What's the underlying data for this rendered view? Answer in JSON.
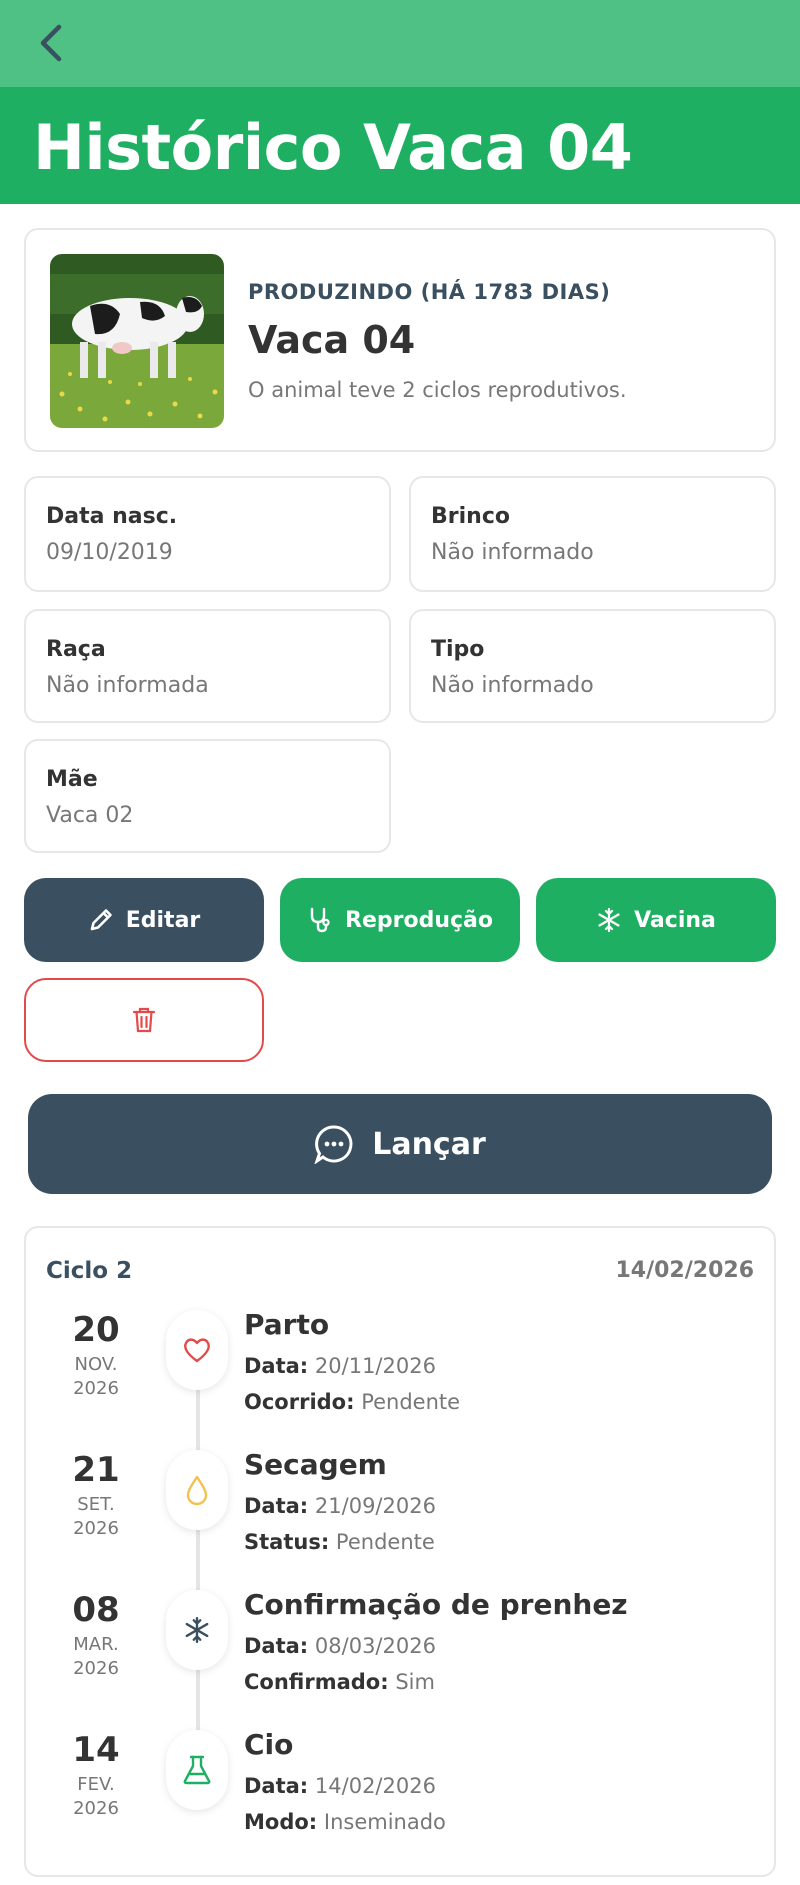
{
  "header": {
    "title": "Histórico Vaca 04"
  },
  "profile": {
    "status": "PRODUZINDO (HÁ 1783 DIAS)",
    "name": "Vaca 04",
    "cycles_text": "O animal teve 2 ciclos reprodutivos."
  },
  "info": [
    {
      "label": "Data nasc.",
      "value": "09/10/2019"
    },
    {
      "label": "Brinco",
      "value": "Não informado"
    },
    {
      "label": "Raça",
      "value": "Não informada"
    },
    {
      "label": "Tipo",
      "value": "Não informado"
    },
    {
      "label": "Mãe",
      "value": "Vaca 02"
    }
  ],
  "actions": {
    "edit": "Editar",
    "reproduction": "Reprodução",
    "vaccine": "Vacina",
    "launch": "Lançar"
  },
  "cycle": {
    "title": "Ciclo 2",
    "date": "14/02/2026",
    "events": [
      {
        "day": "20",
        "month": "NOV.",
        "year": "2026",
        "title": "Parto",
        "k1": "Data:",
        "v1": "20/11/2026",
        "k2": "Ocorrido:",
        "v2": "Pendente",
        "icon": "heart-icon"
      },
      {
        "day": "21",
        "month": "SET.",
        "year": "2026",
        "title": "Secagem",
        "k1": "Data:",
        "v1": "21/09/2026",
        "k2": "Status:",
        "v2": "Pendente",
        "icon": "drop-icon"
      },
      {
        "day": "08",
        "month": "MAR.",
        "year": "2026",
        "title": "Confirmação de prenhez",
        "k1": "Data:",
        "v1": "08/03/2026",
        "k2": "Confirmado:",
        "v2": "Sim",
        "icon": "snowflake-icon"
      },
      {
        "day": "14",
        "month": "FEV.",
        "year": "2026",
        "title": "Cio",
        "k1": "Data:",
        "v1": "14/02/2026",
        "k2": "Modo:",
        "v2": "Inseminado",
        "icon": "flask-icon"
      }
    ]
  },
  "colors": {
    "topbar": "#4fc184",
    "header": "#1faf63",
    "dark": "#3a4f5f",
    "danger": "#e24b4b",
    "heart": "#e24b4b",
    "drop": "#f2c14e",
    "flask": "#1faf63"
  }
}
